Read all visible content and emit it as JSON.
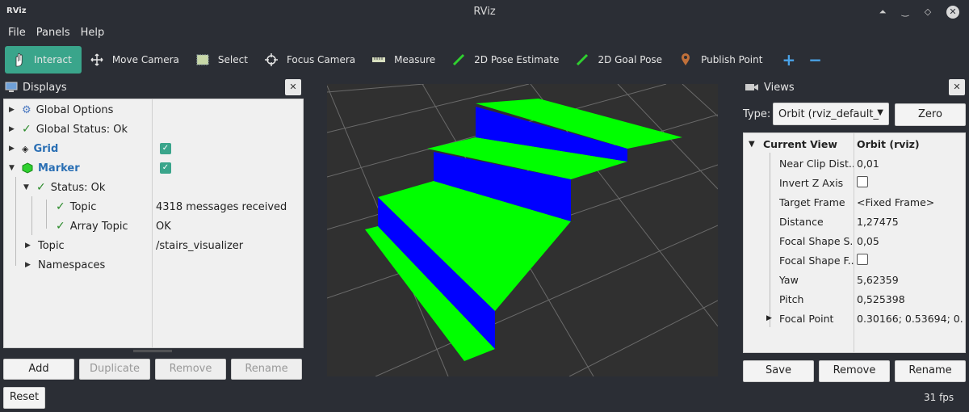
{
  "window": {
    "app_icon": "RViz",
    "title": "RViz"
  },
  "menu": [
    "File",
    "Panels",
    "Help"
  ],
  "toolbar": {
    "tools": [
      {
        "label": "Interact",
        "icon": "hand-icon",
        "active": true
      },
      {
        "label": "Move Camera",
        "icon": "move-icon"
      },
      {
        "label": "Select",
        "icon": "select-icon"
      },
      {
        "label": "Focus Camera",
        "icon": "crosshair-icon"
      },
      {
        "label": "Measure",
        "icon": "ruler-icon"
      },
      {
        "label": "2D Pose Estimate",
        "icon": "arrow-green-icon"
      },
      {
        "label": "2D Goal Pose",
        "icon": "arrow-green-icon"
      },
      {
        "label": "Publish Point",
        "icon": "pin-icon"
      }
    ],
    "plus": "+",
    "minus": "−"
  },
  "displays": {
    "title": "Displays",
    "rows": {
      "global_options": "Global Options",
      "global_status": "Global Status: Ok",
      "grid": "Grid",
      "marker": "Marker",
      "status": "Status: Ok",
      "topic": "Topic",
      "topic_val": "4318 messages received",
      "array_topic": "Array Topic",
      "array_topic_val": "OK",
      "topic2": "Topic",
      "topic2_val": "/stairs_visualizer",
      "namespaces": "Namespaces"
    },
    "buttons": {
      "add": "Add",
      "duplicate": "Duplicate",
      "remove": "Remove",
      "rename": "Rename"
    }
  },
  "views": {
    "title": "Views",
    "type_label": "Type:",
    "type_value": "Orbit (rviz_default_",
    "zero": "Zero",
    "header_key": "Current View",
    "header_val": "Orbit (rviz)",
    "props": [
      {
        "k": "Near Clip Dist...",
        "v": "0,01"
      },
      {
        "k": "Invert Z Axis",
        "v": "",
        "checkbox": true
      },
      {
        "k": "Target Frame",
        "v": "<Fixed Frame>"
      },
      {
        "k": "Distance",
        "v": "1,27475"
      },
      {
        "k": "Focal Shape S...",
        "v": "0,05"
      },
      {
        "k": "Focal Shape F...",
        "v": "",
        "checkbox": true
      },
      {
        "k": "Yaw",
        "v": "5,62359"
      },
      {
        "k": "Pitch",
        "v": "0,525398"
      },
      {
        "k": "Focal Point",
        "v": "0.30166; 0.53694; 0...."
      }
    ],
    "buttons": {
      "save": "Save",
      "remove": "Remove",
      "rename": "Rename"
    }
  },
  "status": {
    "reset": "Reset",
    "fps": "31 fps"
  },
  "colors": {
    "accent": "#3aa58b",
    "step_top": "#00ff00",
    "step_riser": "#0000ff",
    "viewport_bg": "#303030"
  }
}
